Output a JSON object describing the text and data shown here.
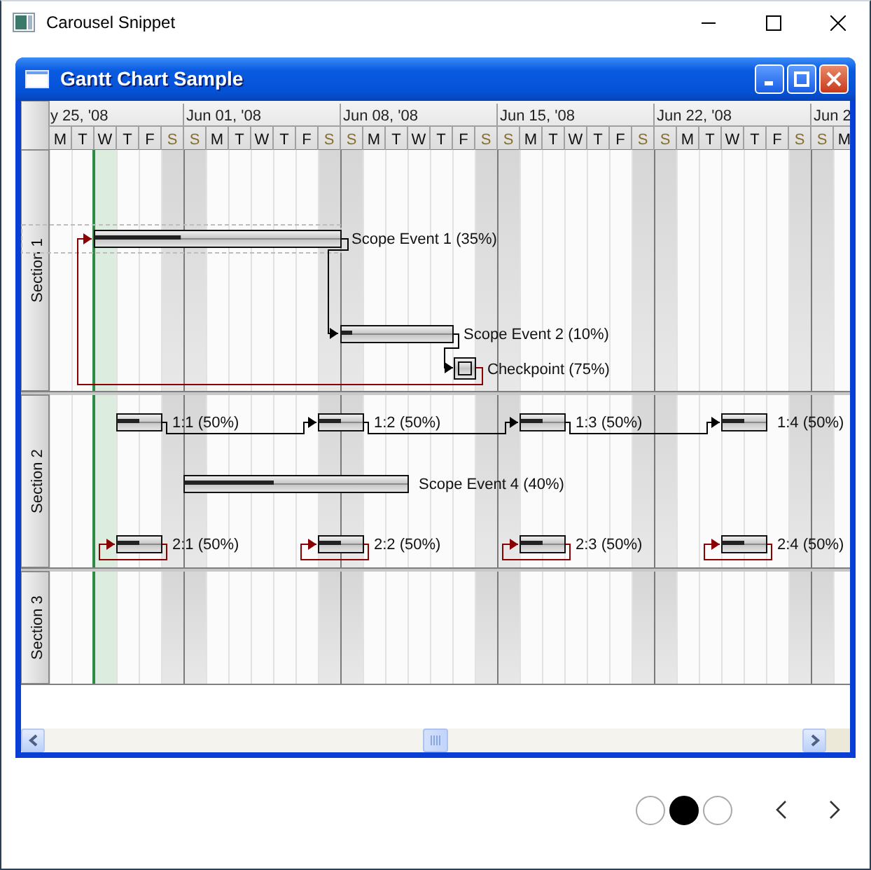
{
  "window": {
    "title": "Carousel Snippet"
  },
  "gantt_window": {
    "title": "Gantt Chart Sample"
  },
  "timeline": {
    "weeks": [
      "y 25, '08",
      "Jun 01, '08",
      "Jun 08, '08",
      "Jun 15, '08",
      "Jun 22, '08",
      "Jun 2"
    ],
    "days": [
      {
        "letter": "M",
        "weekend": false
      },
      {
        "letter": "T",
        "weekend": false
      },
      {
        "letter": "W",
        "weekend": false
      },
      {
        "letter": "T",
        "weekend": false
      },
      {
        "letter": "F",
        "weekend": false
      },
      {
        "letter": "S",
        "weekend": true
      },
      {
        "letter": "S",
        "weekend": true
      },
      {
        "letter": "M",
        "weekend": false
      },
      {
        "letter": "T",
        "weekend": false
      },
      {
        "letter": "W",
        "weekend": false
      },
      {
        "letter": "T",
        "weekend": false
      },
      {
        "letter": "F",
        "weekend": false
      },
      {
        "letter": "S",
        "weekend": true
      },
      {
        "letter": "S",
        "weekend": true
      },
      {
        "letter": "M",
        "weekend": false
      },
      {
        "letter": "T",
        "weekend": false
      },
      {
        "letter": "W",
        "weekend": false
      },
      {
        "letter": "T",
        "weekend": false
      },
      {
        "letter": "F",
        "weekend": false
      },
      {
        "letter": "S",
        "weekend": true
      },
      {
        "letter": "S",
        "weekend": true
      },
      {
        "letter": "M",
        "weekend": false
      },
      {
        "letter": "T",
        "weekend": false
      },
      {
        "letter": "W",
        "weekend": false
      },
      {
        "letter": "T",
        "weekend": false
      },
      {
        "letter": "F",
        "weekend": false
      },
      {
        "letter": "S",
        "weekend": true
      },
      {
        "letter": "S",
        "weekend": true
      },
      {
        "letter": "M",
        "weekend": false
      },
      {
        "letter": "T",
        "weekend": false
      },
      {
        "letter": "W",
        "weekend": false
      },
      {
        "letter": "T",
        "weekend": false
      },
      {
        "letter": "F",
        "weekend": false
      },
      {
        "letter": "S",
        "weekend": true
      },
      {
        "letter": "S",
        "weekend": true
      },
      {
        "letter": "M",
        "weekend": false
      }
    ]
  },
  "sections": [
    {
      "label": "Section 1",
      "events": [
        {
          "kind": "task",
          "label": "Scope Event 1 (35%)",
          "level": 0.35
        },
        {
          "kind": "task",
          "label": "Scope Event 2 (10%)",
          "level": 0.1
        },
        {
          "kind": "milestone",
          "label": "Checkpoint (75%)"
        }
      ]
    },
    {
      "label": "Section 2",
      "events": [
        {
          "kind": "task",
          "label": "1:1 (50%)",
          "level": 0.5
        },
        {
          "kind": "task",
          "label": "1:2 (50%)",
          "level": 0.5
        },
        {
          "kind": "task",
          "label": "1:3 (50%)",
          "level": 0.5
        },
        {
          "kind": "task",
          "label": "1:4 (50%)",
          "level": 0.5
        },
        {
          "kind": "task",
          "label": "Scope Event 4 (40%)",
          "level": 0.4
        },
        {
          "kind": "task",
          "label": "2:1 (50%)",
          "level": 0.5
        },
        {
          "kind": "task",
          "label": "2:2 (50%)",
          "level": 0.5
        },
        {
          "kind": "task",
          "label": "2:3 (50%)",
          "level": 0.5
        },
        {
          "kind": "task",
          "label": "2:4 (50%)",
          "level": 0.5
        }
      ]
    },
    {
      "label": "Section 3"
    }
  ],
  "carousel": {
    "indicators": [
      {
        "selected": false
      },
      {
        "selected": true
      },
      {
        "selected": false
      }
    ]
  }
}
